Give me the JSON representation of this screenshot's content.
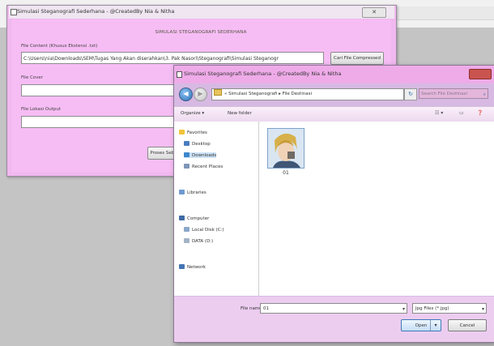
{
  "main_window": {
    "title": "Simulasi Steganografi Sederhana - @CreatedBy Nia & Nitha",
    "close_label": "✕",
    "heading": "SIMULASI STEGANOGRAFI SEDERHANA",
    "file_content_label": "File Content (Khusus Ekstensi .txt)",
    "file_content_value": "C:\\Users\\nia\\Downloads\\SEM\\Tugas Yang Akan diserahkan\\3. Pak Nasori\\Steganografi\\Simulasi Steganogr",
    "file_compressed_button": "Cari File Compressed",
    "file_cover_label": "File Cover",
    "file_cover_value": "",
    "file_output_label": "File Lokasi Output",
    "file_output_value": "",
    "process_button": "Proses Seba"
  },
  "dialog": {
    "title": "Simulasi Steganografi Sederhana - @CreatedBy Nia & Nitha",
    "breadcrumb": "« Simulasi Steganografi ▸ File Destinasi",
    "search_placeholder": "Search File Destinasi",
    "toolbar": {
      "organize": "Organize ▾",
      "new_folder": "New folder"
    },
    "nav_pane": {
      "favorites": "Favorites",
      "desktop": "Desktop",
      "downloads": "Downloads",
      "recent_places": "Recent Places",
      "libraries": "Libraries",
      "computer": "Computer",
      "local_disk": "Local Disk (C:)",
      "data_drive": "DATA (D:)",
      "network": "Network"
    },
    "file_item_label": "01",
    "file_name_label": "File name:",
    "file_name_value": "01",
    "file_type_value": "Jpg Files (*.jpg)",
    "open_button": "Open",
    "cancel_button": "Cancel"
  }
}
